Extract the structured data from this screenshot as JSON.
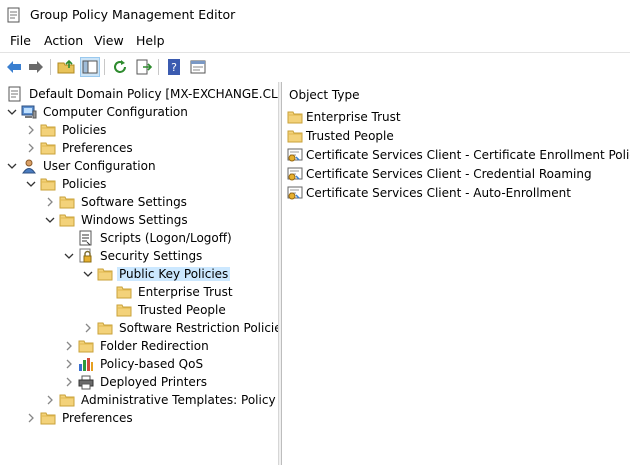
{
  "window": {
    "title": "Group Policy Management Editor"
  },
  "menu": [
    {
      "label": "File"
    },
    {
      "label": "Action"
    },
    {
      "label": "View"
    },
    {
      "label": "Help"
    }
  ],
  "toolbar": {
    "buttons": [
      "back-icon",
      "forward-icon",
      "up-folder-icon",
      "show-hide-tree-icon",
      "refresh-icon",
      "export-list-icon",
      "help-icon",
      "properties-icon"
    ]
  },
  "tree": [
    {
      "label": "Default Domain Policy [MX-EXCHANGE.CLICKS",
      "icon": "policy-document-icon",
      "exp": "",
      "level": 0
    },
    {
      "label": "Computer Configuration",
      "icon": "computer-icon",
      "exp": "open",
      "level": 1
    },
    {
      "label": "Policies",
      "icon": "folder-icon",
      "exp": "closed",
      "level": 2
    },
    {
      "label": "Preferences",
      "icon": "folder-icon",
      "exp": "closed",
      "level": 2
    },
    {
      "label": "User Configuration",
      "icon": "user-icon",
      "exp": "open",
      "level": 1
    },
    {
      "label": "Policies",
      "icon": "folder-icon",
      "exp": "open",
      "level": 2
    },
    {
      "label": "Software Settings",
      "icon": "folder-icon",
      "exp": "closed",
      "level": 3
    },
    {
      "label": "Windows Settings",
      "icon": "folder-icon",
      "exp": "open",
      "level": 3
    },
    {
      "label": "Scripts (Logon/Logoff)",
      "icon": "script-icon",
      "exp": "",
      "level": 4
    },
    {
      "label": "Security Settings",
      "icon": "security-lock-icon",
      "exp": "open",
      "level": 4
    },
    {
      "label": "Public Key Policies",
      "icon": "folder-icon",
      "exp": "open",
      "level": 5,
      "selected": true
    },
    {
      "label": "Enterprise Trust",
      "icon": "folder-icon",
      "exp": "",
      "level": 6
    },
    {
      "label": "Trusted People",
      "icon": "folder-icon",
      "exp": "",
      "level": 6
    },
    {
      "label": "Software Restriction Policies",
      "icon": "folder-icon",
      "exp": "closed",
      "level": 5
    },
    {
      "label": "Folder Redirection",
      "icon": "folder-icon",
      "exp": "closed",
      "level": 4
    },
    {
      "label": "Policy-based QoS",
      "icon": "qos-chart-icon",
      "exp": "closed",
      "level": 4
    },
    {
      "label": "Deployed Printers",
      "icon": "printer-icon",
      "exp": "closed",
      "level": 4
    },
    {
      "label": "Administrative Templates: Policy def",
      "icon": "folder-icon",
      "exp": "closed",
      "level": 3
    },
    {
      "label": "Preferences",
      "icon": "folder-icon",
      "exp": "closed",
      "level": 2
    }
  ],
  "right_panel": {
    "column_header": "Object Type",
    "items": [
      {
        "label": "Enterprise Trust",
        "icon": "folder-icon"
      },
      {
        "label": "Trusted People",
        "icon": "folder-icon"
      },
      {
        "label": "Certificate Services Client - Certificate Enrollment Policy",
        "icon": "certificate-icon"
      },
      {
        "label": "Certificate Services Client - Credential Roaming",
        "icon": "certificate-icon"
      },
      {
        "label": "Certificate Services Client - Auto-Enrollment",
        "icon": "certificate-icon"
      }
    ]
  }
}
